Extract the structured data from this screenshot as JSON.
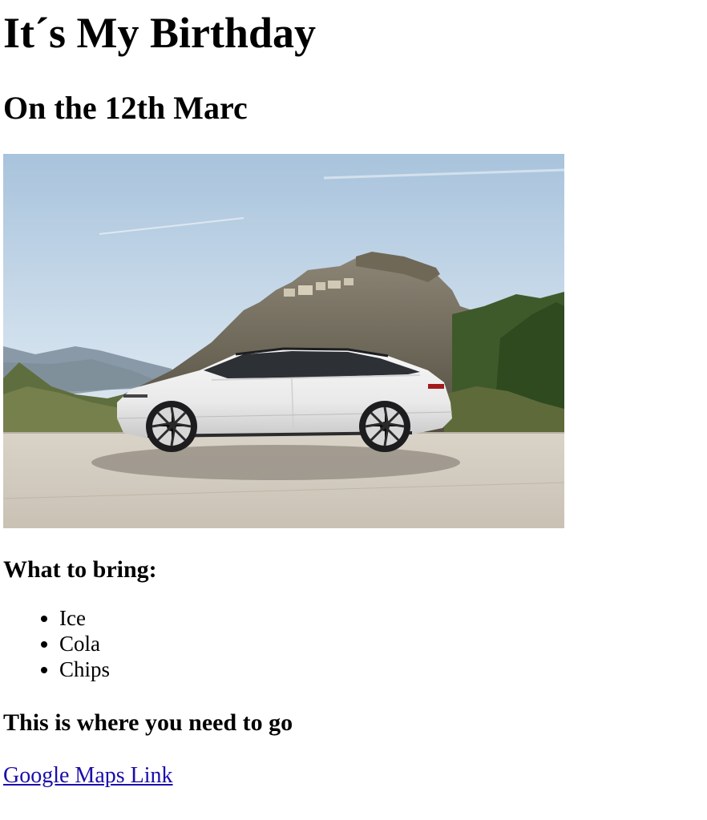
{
  "page": {
    "title": "It´s My Birthday",
    "subtitle": "On the 12th Marc"
  },
  "hero_image": {
    "alt": "White electric sedan parked in front of a rocky hill with a village on top"
  },
  "bring": {
    "heading": "What to bring:",
    "items": [
      "Ice",
      "Cola",
      "Chips"
    ]
  },
  "location": {
    "heading": "This is where you need to go",
    "link_label": "Google Maps Link"
  },
  "colors": {
    "link": "#1a0dab",
    "text": "#000000",
    "background": "#ffffff"
  }
}
